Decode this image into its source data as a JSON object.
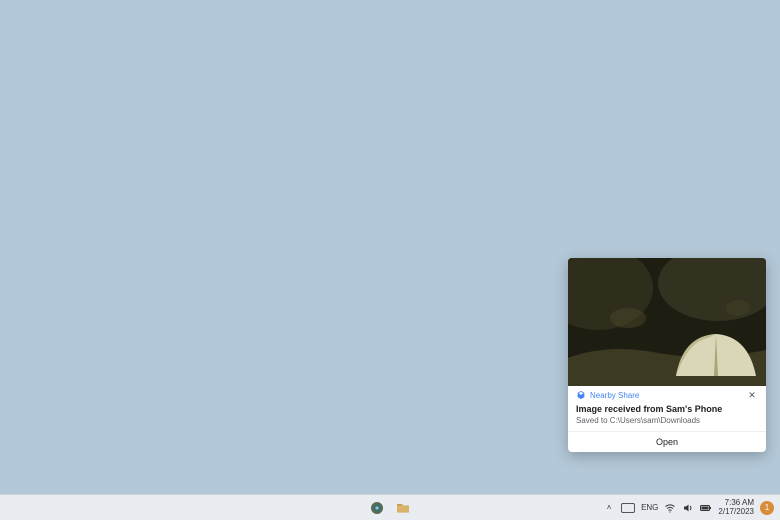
{
  "notification": {
    "app_name": "Nearby Share",
    "title": "Image received from Sam's Phone",
    "subtitle": "Saved to C:\\Users\\sam\\Downloads",
    "action": "Open"
  },
  "taskbar": {
    "lang": "ENG",
    "time": "7:36 AM",
    "date": "2/17/2023",
    "notif_count": "1"
  },
  "icons": {
    "close": "✕",
    "chevron_up": "˄"
  }
}
